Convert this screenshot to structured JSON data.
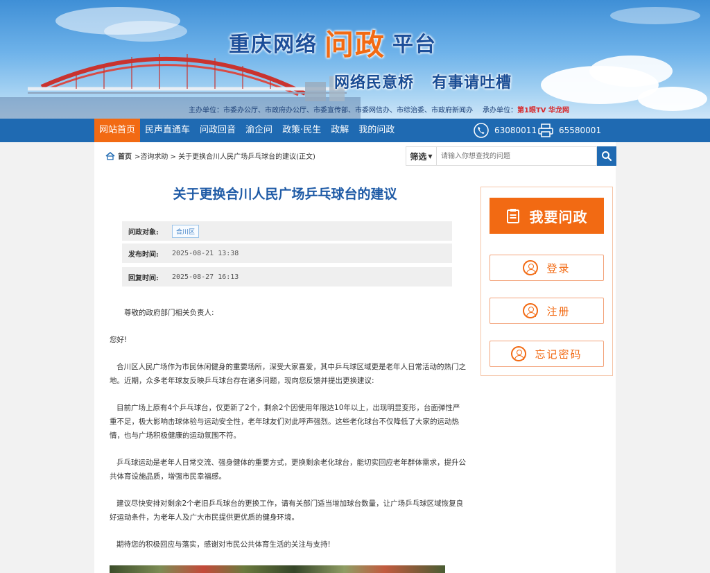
{
  "banner": {
    "title_part1": "重庆网络",
    "title_highlight": "问政",
    "title_part2": "平台",
    "slogan_left": "网络民意桥",
    "slogan_right": "有事请吐槽",
    "organizers": "主办单位：市委办公厅、市政府办公厅、市委宣传部、市委网信办、市综治委、市政府新闻办",
    "undertaker_label": "承办单位：",
    "undertaker_logo": "第1眼TV 华龙网"
  },
  "nav": {
    "items": [
      {
        "label": "网站首页",
        "active": true
      },
      {
        "label": "民声直通车",
        "active": false
      },
      {
        "label": "问政回音",
        "active": false
      },
      {
        "label": "渝企问",
        "active": false
      },
      {
        "label": "政策·民生",
        "active": false
      },
      {
        "label": "政解",
        "active": false
      },
      {
        "label": "我的问政",
        "active": false
      }
    ],
    "phone": "63080011",
    "fax": "65580001"
  },
  "breadcrumb": {
    "home": "首页",
    "path": ">咨询求助 > 关于更换合川人民广场乒乓球台的建议(正文)"
  },
  "search": {
    "filter_label": "筛选",
    "placeholder": "请输入你想查找的问题"
  },
  "article": {
    "title": "关于更换合川人民广场乒乓球台的建议",
    "target_label": "问政对象:",
    "target_value": "合川区",
    "publish_label": "发布时间:",
    "publish_time": "2025-08-21 13:38",
    "reply_label": "回复时间:",
    "reply_time": "2025-08-27 16:13",
    "salutation": "尊敬的政府部门相关负责人:",
    "greeting": "您好!",
    "p1": "合川区人民广场作为市民休闲健身的重要场所，深受大家喜爱，其中乒乓球区域更是老年人日常活动的热门之地。近期，众多老年球友反映乒乓球台存在诸多问题，现向您反馈并提出更换建议:",
    "p2": "目前广场上原有4个乒乓球台，仅更新了2个，剩余2个因使用年限达10年以上，出现明显变形，台面弹性严重不足，极大影响击球体验与运动安全性，老年球友们对此呼声强烈。这些老化球台不仅降低了大家的运动热情，也与广场积极健康的运动氛围不符。",
    "p3": "乒乓球运动是老年人日常交流、强身健体的重要方式，更换剩余老化球台，能切实回应老年群体需求，提升公共体育设施品质，增强市民幸福感。",
    "p4": "建议尽快安排对剩余2个老旧乒乓球台的更换工作，请有关部门适当增加球台数量，让广场乒乓球区域恢复良好运动条件，为老年人及广大市民提供更优质的健身环境。",
    "p5": "期待您的积极回应与落实，感谢对市民公共体育生活的关注与支持!"
  },
  "panel": {
    "ask_label": "我要问政",
    "login_label": "登录",
    "register_label": "注册",
    "forgot_label": "忘记密码"
  },
  "colors": {
    "primary_blue": "#1f6ab2",
    "accent_orange": "#f26a13",
    "title_blue": "#1f5ba6"
  }
}
